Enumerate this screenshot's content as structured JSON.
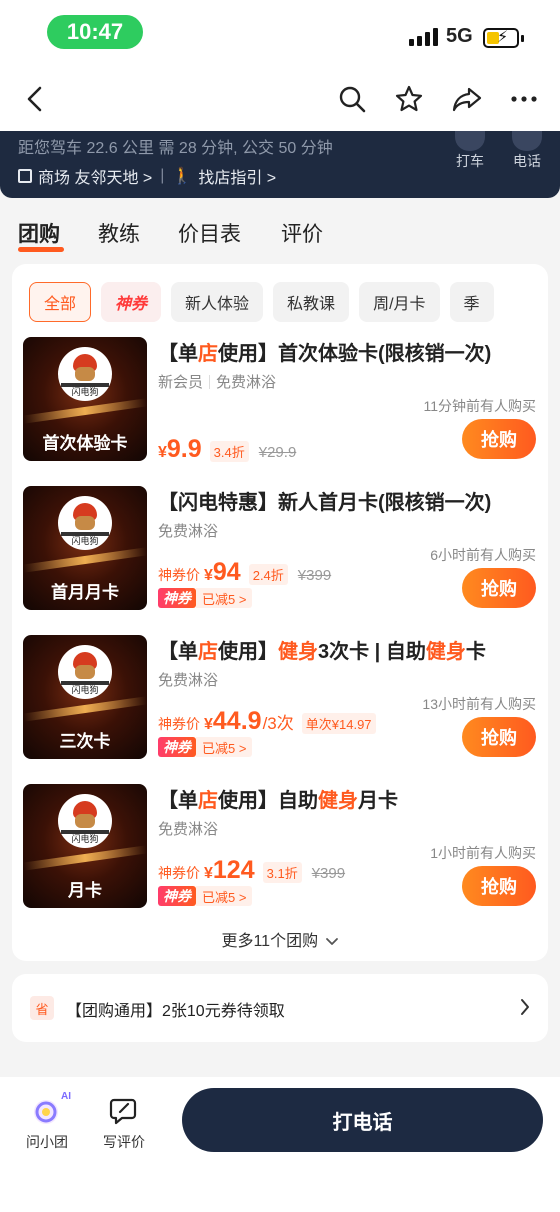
{
  "status": {
    "time": "10:47",
    "network": "5G"
  },
  "info": {
    "distance": "距您驾车 22.6 公里 需 28 分钟, 公交 50 分钟",
    "mall": "商场 友邻天地 >",
    "guide": "找店指引 >",
    "taxi_label": "打车",
    "phone_label": "电话"
  },
  "tabs": [
    "团购",
    "教练",
    "价目表",
    "评价"
  ],
  "chips": [
    "全部",
    "神券",
    "新人体验",
    "私教课",
    "周/月卡",
    "季"
  ],
  "deals": [
    {
      "title_pre": "【单",
      "title_hl": "店",
      "title_post": "使用】首次体验卡(限核销一次)",
      "tag1": "新会员",
      "tag2": "免费淋浴",
      "recent": "11分钟前有人购买",
      "price_prefix": "",
      "yen": "¥",
      "price": "9.9",
      "unit": "",
      "discount": "3.4折",
      "orig": "¥29.9",
      "caption": "首次体验卡",
      "buy": "抢购"
    },
    {
      "title_pre": "【闪电特惠】新人首月卡(限核销一次)",
      "tag1": "免费淋浴",
      "recent": "6小时前有人购买",
      "price_prefix": "神券价",
      "yen": "¥",
      "price": "94",
      "unit": "",
      "discount": "2.4折",
      "orig": "¥399",
      "badge": "神券",
      "reduce": "已减5 >",
      "caption": "首月月卡",
      "buy": "抢购"
    },
    {
      "title_pre": "【单",
      "title_hl": "店",
      "title_mid": "使用】",
      "title_hl2": "健身",
      "title_mid2": "3次卡 | 自助",
      "title_hl3": "健身",
      "title_post": "卡",
      "tag1": "免费淋浴",
      "recent": "13小时前有人购买",
      "price_prefix": "神券价",
      "yen": "¥",
      "price": "44.9",
      "unit": "/3次",
      "discount": "单次¥14.97",
      "orig": "",
      "badge": "神券",
      "reduce": "已减5 >",
      "caption": "三次卡",
      "buy": "抢购"
    },
    {
      "title_pre": "【单",
      "title_hl": "店",
      "title_mid": "使用】自助",
      "title_hl2": "健身",
      "title_post": "月卡",
      "tag1": "免费淋浴",
      "recent": "1小时前有人购买",
      "price_prefix": "神券价",
      "yen": "¥",
      "price": "124",
      "unit": "",
      "discount": "3.1折",
      "orig": "¥399",
      "badge": "神券",
      "reduce": "已减5 >",
      "caption": "月卡",
      "buy": "抢购"
    }
  ],
  "logo_text": "闪电狗",
  "more": "更多11个团购",
  "coupon": {
    "sheng": "省",
    "text": "【团购通用】2张10元券待领取"
  },
  "bottom": {
    "ask": "问小团",
    "ask_badge": "AI",
    "review": "写评价",
    "call": "打电话"
  },
  "colors": {
    "accent": "#ff5a1f",
    "dark": "#1d2a42",
    "status_green": "#2ecc5f"
  }
}
